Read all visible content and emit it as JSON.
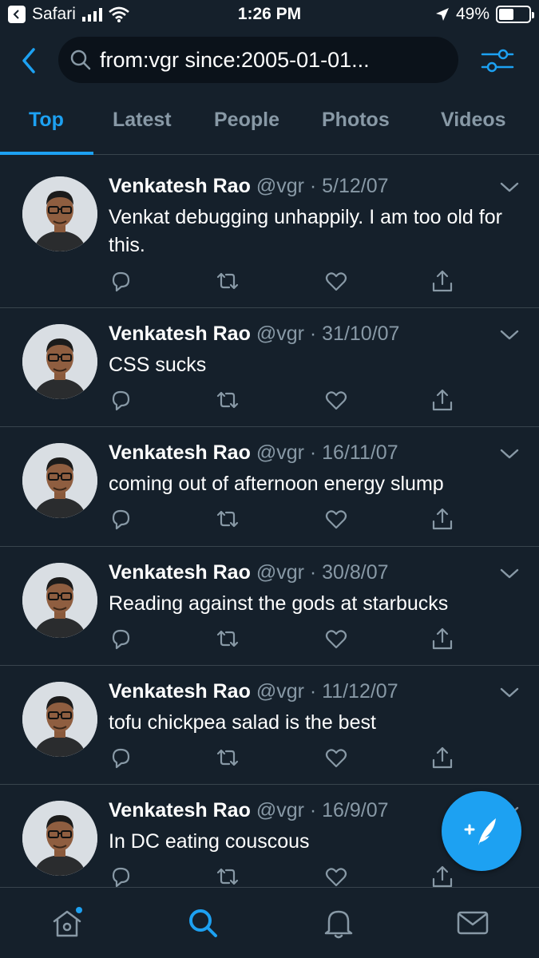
{
  "status_bar": {
    "app": "Safari",
    "time": "1:26 PM",
    "battery": "49%",
    "battery_level": 0.49
  },
  "search": {
    "query": "from:vgr since:2005-01-01..."
  },
  "tabs": [
    {
      "label": "Top",
      "active": true
    },
    {
      "label": "Latest",
      "active": false
    },
    {
      "label": "People",
      "active": false
    },
    {
      "label": "Photos",
      "active": false
    },
    {
      "label": "Videos",
      "active": false
    }
  ],
  "tweets": [
    {
      "name": "Venkatesh Rao",
      "handle": "@vgr",
      "sep": "·",
      "date": "5/12/07",
      "text": "Venkat debugging unhappily. I am too old for this."
    },
    {
      "name": "Venkatesh Rao",
      "handle": "@vgr",
      "sep": "·",
      "date": "31/10/07",
      "text": "CSS sucks"
    },
    {
      "name": "Venkatesh Rao",
      "handle": "@vgr",
      "sep": "·",
      "date": "16/11/07",
      "text": "coming out of afternoon energy slump"
    },
    {
      "name": "Venkatesh Rao",
      "handle": "@vgr",
      "sep": "·",
      "date": "30/8/07",
      "text": "Reading against the gods at starbucks"
    },
    {
      "name": "Venkatesh Rao",
      "handle": "@vgr",
      "sep": "·",
      "date": "11/12/07",
      "text": "tofu chickpea salad is the best"
    },
    {
      "name": "Venkatesh Rao",
      "handle": "@vgr",
      "sep": "·",
      "date": "16/9/07",
      "text": "In DC eating couscous"
    }
  ],
  "icons": {
    "reply": "reply-icon",
    "retweet": "retweet-icon",
    "like": "heart-icon",
    "share": "share-icon",
    "compose": "compose-tweet-icon"
  },
  "colors": {
    "background": "#15202b",
    "accent": "#1da1f2",
    "muted": "#8899a6",
    "divider": "#38444d"
  }
}
